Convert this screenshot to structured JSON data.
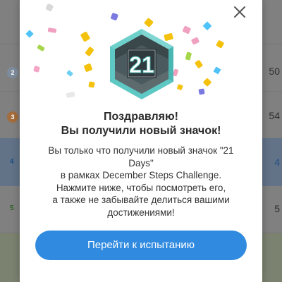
{
  "background": {
    "rows": [
      {
        "rank": "2",
        "score": "50"
      },
      {
        "rank": "3",
        "score": "54"
      },
      {
        "rank": "4",
        "score": "4"
      },
      {
        "rank": "5",
        "score": "5"
      }
    ]
  },
  "modal": {
    "close_icon": "close-icon",
    "badge": {
      "number": "21",
      "icon": "badge-hexagon-icon"
    },
    "title_line1": "Поздравляю!",
    "title_line2": "Вы получили новый значок!",
    "body_line1": "Вы только что получили новый значок \"21",
    "body_line2": "Days\"",
    "body_line3": "в рамках December Steps Challenge.",
    "body_line4": "Нажмите ниже, чтобы посмотреть его,",
    "body_line5": "а также не забывайте делиться вашими",
    "body_line6": "достижениями!",
    "cta_label": "Перейти к испытанию"
  },
  "colors": {
    "accent": "#2f8ae0",
    "overlay": "#808080",
    "badge_teal": "#5ec8c4",
    "badge_dark": "#2f3a3e"
  }
}
